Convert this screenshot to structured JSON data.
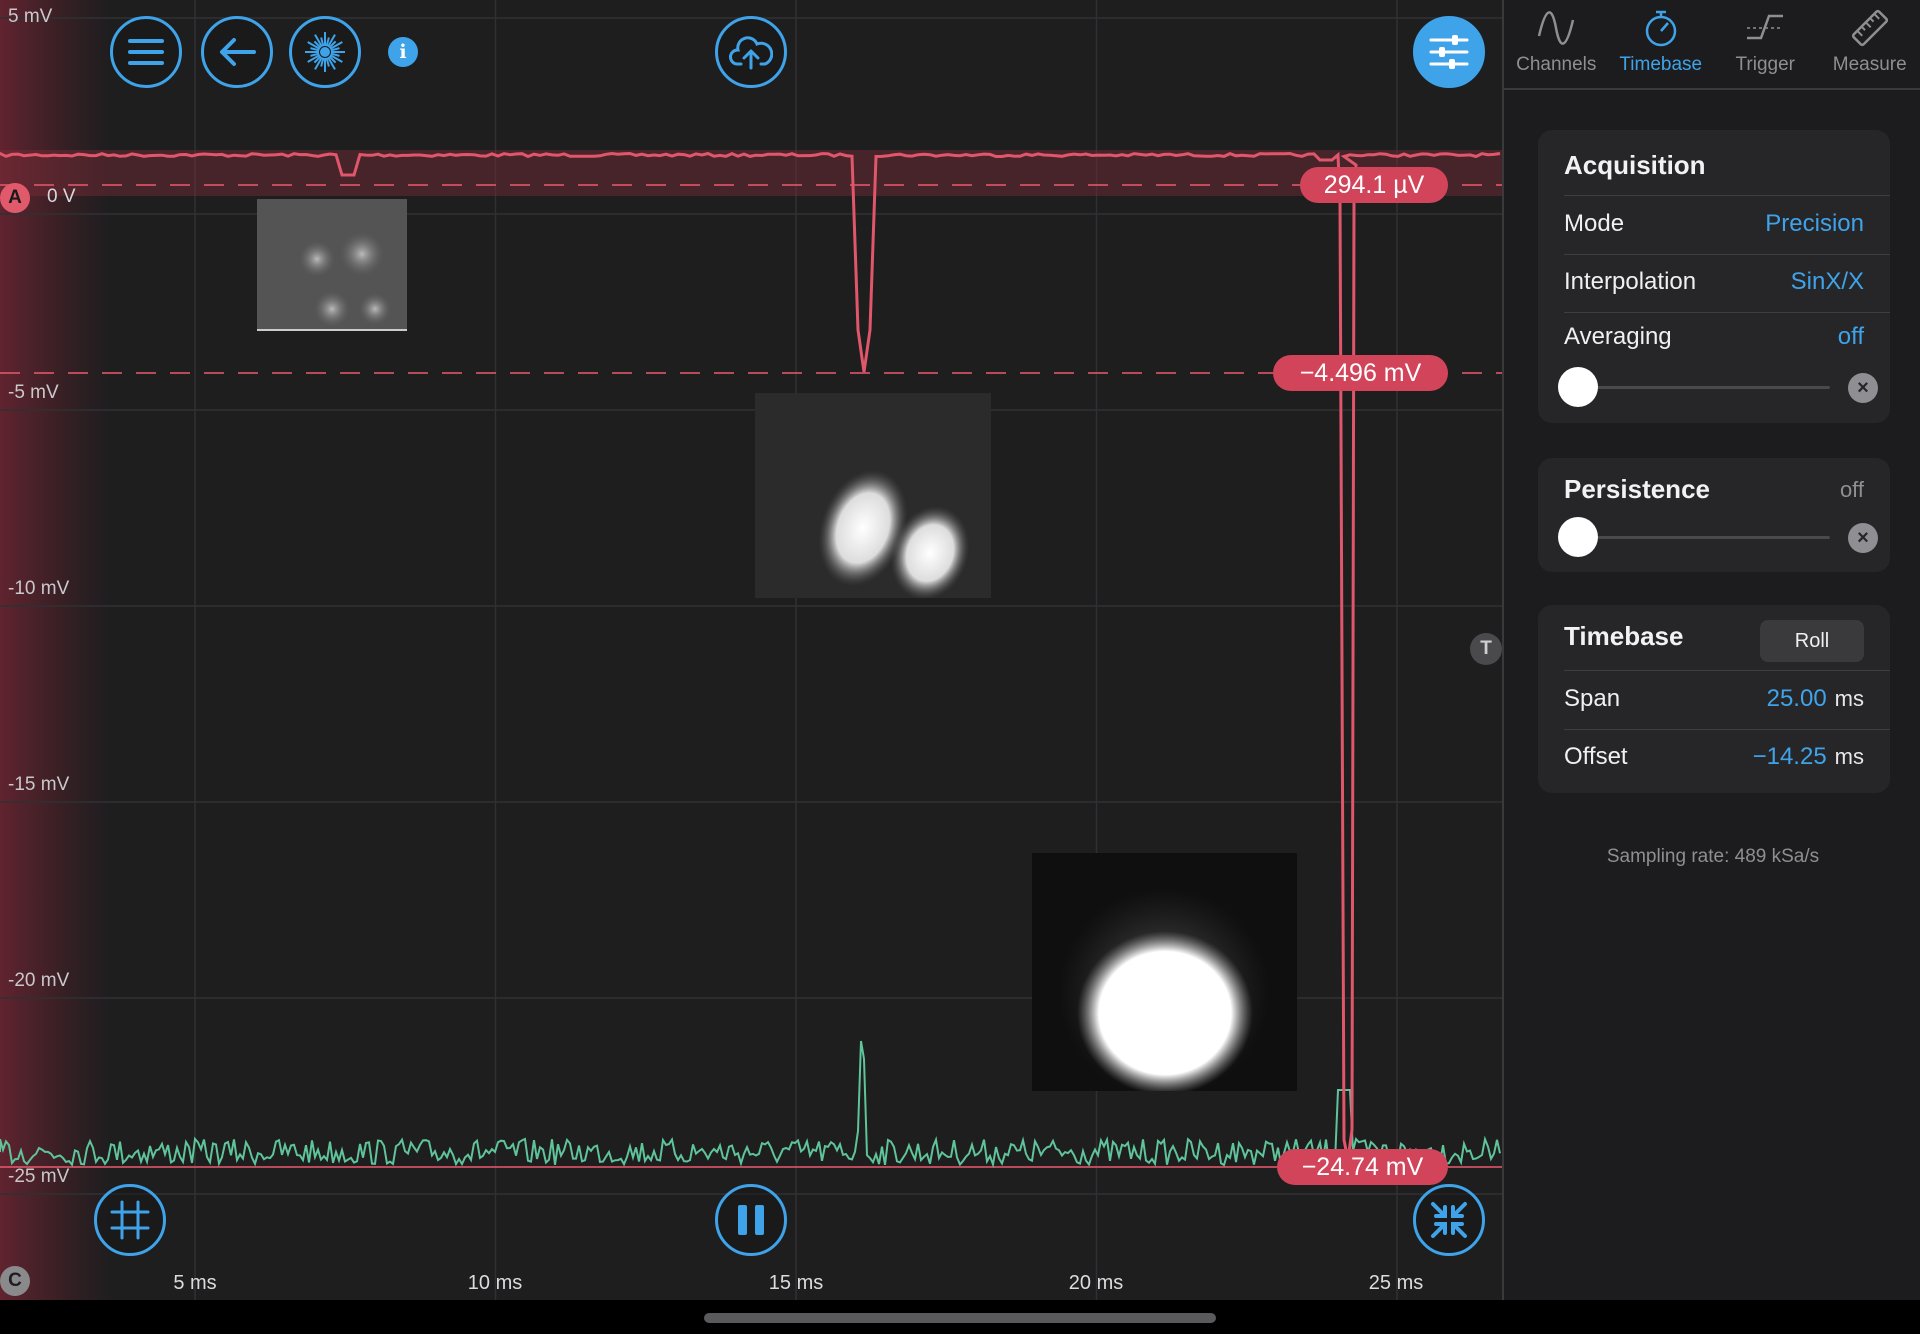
{
  "toolbar": {
    "menu_icon": "menu-icon",
    "back_icon": "back-arrow-icon",
    "laser_icon": "sunburst-icon",
    "info_label": "i",
    "upload_icon": "cloud-upload-icon",
    "settings_icon": "sliders-icon"
  },
  "scope": {
    "y_labels": [
      "5 mV",
      "-5 mV",
      "-10 mV",
      "-15 mV",
      "-20 mV",
      "-25 mV"
    ],
    "x_labels": [
      "5 ms",
      "10 ms",
      "15 ms",
      "20 ms",
      "25 ms"
    ],
    "channel_a_marker": "A",
    "channel_a_zero": "0 V",
    "trigger_marker": "T",
    "channel_c_marker": "C",
    "cursor_values": [
      "294.1 µV",
      "−4.496 mV",
      "−24.74 mV"
    ],
    "channel_a_color": "#e0566b",
    "channel_c_color": "#5fc49a",
    "accent_color": "#3fa3ea"
  },
  "bottom_controls": {
    "grid_icon": "grid-cursor-icon",
    "pause_icon": "pause-icon",
    "collapse_icon": "collapse-arrows-icon"
  },
  "panel": {
    "tabs": [
      {
        "label": "Channels",
        "icon": "sine-wave-icon"
      },
      {
        "label": "Timebase",
        "icon": "stopwatch-icon"
      },
      {
        "label": "Trigger",
        "icon": "trigger-edge-icon"
      },
      {
        "label": "Measure",
        "icon": "ruler-icon"
      }
    ],
    "active_tab": "Timebase",
    "acquisition": {
      "title": "Acquisition",
      "mode_label": "Mode",
      "mode_value": "Precision",
      "interpolation_label": "Interpolation",
      "interpolation_value": "SinX/X",
      "averaging_label": "Averaging",
      "averaging_value": "off",
      "averaging_level": 0
    },
    "persistence": {
      "title": "Persistence",
      "value": "off",
      "level": 0
    },
    "timebase": {
      "title": "Timebase",
      "roll_label": "Roll",
      "span_label": "Span",
      "span_value": "25.00",
      "span_unit": "ms",
      "offset_label": "Offset",
      "offset_value": "−14.25",
      "offset_unit": "ms"
    },
    "sampling_rate": "Sampling rate: 489 kSa/s"
  }
}
